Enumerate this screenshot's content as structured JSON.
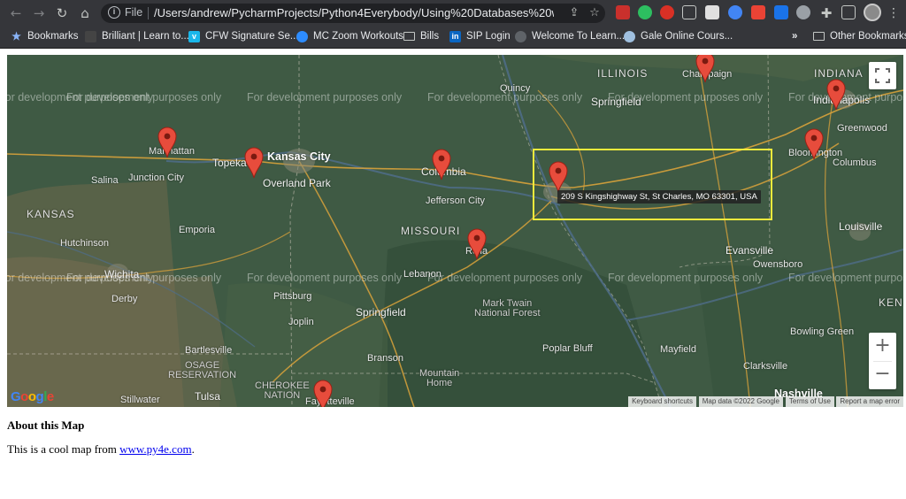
{
  "browser": {
    "omnibox": {
      "scheme_label": "File",
      "url": "/Users/andrew/PycharmProjects/Python4Everybody/Using%20Databases%20with%2..."
    },
    "bookmarks": [
      {
        "label": "Bookmarks",
        "icon": "star-icon"
      },
      {
        "label": "Brilliant | Learn to...",
        "icon": "brilliant-icon"
      },
      {
        "label": "CFW Signature Se...",
        "icon": "vimeo-icon"
      },
      {
        "label": "MC Zoom Workouts",
        "icon": "zoom-icon"
      },
      {
        "label": "Bills",
        "icon": "folder-icon"
      },
      {
        "label": "SIP Login",
        "icon": "linkedin-icon"
      },
      {
        "label": "Welcome To Learn...",
        "icon": "learn-icon"
      },
      {
        "label": "Gale Online Cours...",
        "icon": "gale-icon"
      }
    ],
    "overflow_label": "»",
    "other_bookmarks": "Other Bookmarks"
  },
  "map": {
    "watermark": "For development purposes only",
    "tooltip": "209 S Kingshighway St, St Charles, MO 63301, USA",
    "zoom_in": "+",
    "zoom_out": "−",
    "google_logo": "Google",
    "attribution": {
      "shortcuts": "Keyboard shortcuts",
      "data": "Map data ©2022 Google",
      "terms": "Terms of Use",
      "report": "Report a map error"
    },
    "places": {
      "illinois": "ILLINOIS",
      "indiana": "INDIANA",
      "kansas": "KANSAS",
      "missouri": "MISSOURI",
      "ken": "KEN",
      "kansas_city": "Kansas City",
      "overland_park": "Overland Park",
      "topeka": "Topeka",
      "manhattan": "Manhattan",
      "junction_city": "Junction City",
      "salina": "Salina",
      "emporia": "Emporia",
      "hutchinson": "Hutchinson",
      "wichita": "Wichita",
      "derby": "Derby",
      "pittsburg": "Pittsburg",
      "joplin": "Joplin",
      "bartlesville": "Bartlesville",
      "stillwater": "Stillwater",
      "tulsa": "Tulsa",
      "osage": "OSAGE\nRESERVATION",
      "cherokee": "CHEROKEE\nNATION",
      "columbia": "Columbia",
      "jefferson_city": "Jefferson City",
      "rolla": "Rolla",
      "springfield_mo": "Springfield",
      "branson": "Branson",
      "mark_twain": "Mark Twain\nNational Forest",
      "quincy": "Quincy",
      "springfield_il": "Springfield",
      "champaign": "Champaign",
      "indianapolis": "Indianapolis",
      "bloomington": "Bloomington",
      "columbus": "Columbus",
      "greenwood": "Greenwood",
      "louisville": "Louisville",
      "evansville": "Evansville",
      "owensboro": "Owensboro",
      "bowling_green": "Bowling Green",
      "clarksville": "Clarksville",
      "nashville": "Nashville",
      "poplar_bluff": "Poplar Bluff",
      "mayfield": "Mayfield",
      "mountain_home": "Mountain\nHome",
      "fayetteville": "Fayetteville",
      "lebanon": "Lebanon"
    }
  },
  "page": {
    "heading": "About this Map",
    "text_before": "This is a cool map from ",
    "link": "www.py4e.com",
    "text_after": "."
  },
  "colors": {
    "marker": "#e74c3c",
    "tooltip_highlight": "#f1ea3c",
    "link": "#0000ee"
  }
}
